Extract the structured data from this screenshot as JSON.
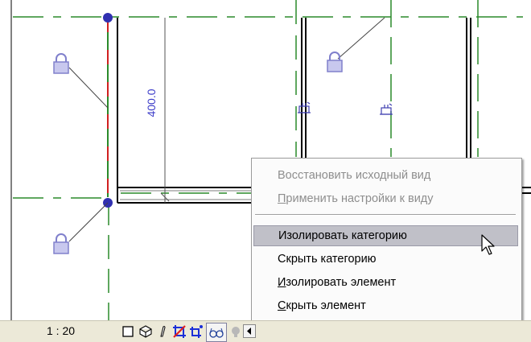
{
  "drawing": {
    "dimension_label": "400.0"
  },
  "context_menu": {
    "items": [
      {
        "label": "Восстановить исходный вид",
        "state": "disabled"
      },
      {
        "label_underlined": "П",
        "label_rest": "рименить настройки к виду",
        "state": "disabled"
      },
      {
        "label": "Изолировать категорию",
        "state": "highlighted"
      },
      {
        "label": "Скрыть категорию",
        "state": "normal"
      },
      {
        "label_underlined": "И",
        "label_rest": "золировать элемент",
        "state": "normal"
      },
      {
        "label_underlined": "С",
        "label_rest": "крыть элемент",
        "state": "normal"
      }
    ]
  },
  "status_bar": {
    "scale": "1 : 20",
    "icons": [
      "detail-level-icon",
      "visual-style-icon",
      "sun-path-icon",
      "crop-view-icon",
      "show-crop-icon",
      "temporary-hide-isolate-icon",
      "reveal-hidden-icon",
      "scroll-left-icon"
    ]
  },
  "colors": {
    "grid_line": "#2a8a2a",
    "dimension_text": "#3a3ac8",
    "lock_icon": "#8080cc",
    "menu_highlight": "#c0c0c8"
  }
}
